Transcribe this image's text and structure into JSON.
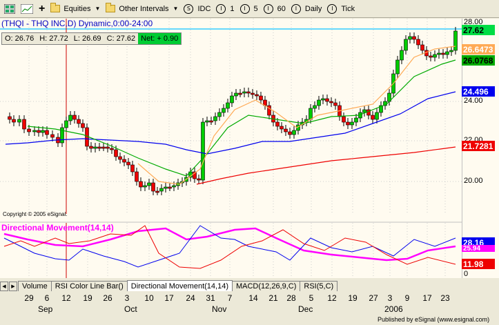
{
  "toolbar": {
    "items": [
      {
        "name": "grid-icon",
        "label": ""
      },
      {
        "name": "chart-icon",
        "label": ""
      },
      {
        "name": "plus-icon",
        "label": "+"
      },
      {
        "name": "equities-menu",
        "label": "Equities"
      },
      {
        "name": "other-intervals-menu",
        "label": "Other Intervals"
      },
      {
        "name": "interval-s",
        "glyph": "S",
        "label": "IDC"
      },
      {
        "name": "interval-1",
        "glyph": "I",
        "label": "1"
      },
      {
        "name": "interval-5",
        "glyph": "I",
        "label": "5"
      },
      {
        "name": "interval-60",
        "glyph": "I",
        "label": "60"
      },
      {
        "name": "interval-daily",
        "glyph": "I",
        "label": "Daily"
      },
      {
        "name": "interval-tick",
        "glyph": "I",
        "label": "Tick"
      }
    ]
  },
  "chart": {
    "title": "(THQI - THQ INC,D) Dynamic,0:00-24:00",
    "ohlc": {
      "o": "O: 26.76",
      "h": "H: 27.72",
      "l": "L: 26.69",
      "c": "C: 27.62",
      "net": "Net: + 0.90"
    },
    "copyright": "Copyright © 2005 eSignal.",
    "price_axis": [
      "28.00",
      "24.00",
      "22.00",
      "20.00"
    ],
    "tags": [
      {
        "label": "27.62",
        "bg": "#00dd44",
        "fg": "#000000"
      },
      {
        "label": "26.6473",
        "bg": "#ffaa55",
        "fg": "#ffffff"
      },
      {
        "label": "26.0768",
        "bg": "#00aa00",
        "fg": "#000000"
      },
      {
        "label": "24.496",
        "bg": "#0000ee",
        "fg": "#ffffff"
      },
      {
        "label": "21.7281",
        "bg": "#ee0000",
        "fg": "#ffffff"
      }
    ],
    "indicator_title": "Directional Movement(14,14)",
    "indicator_axis": [
      "0"
    ],
    "indicator_tags": [
      {
        "label": "28.16",
        "bg": "#0000ee",
        "fg": "#ffffff"
      },
      {
        "label": "25.94",
        "bg": "#ff00ff",
        "fg": "#ffffff"
      },
      {
        "label": "11.98",
        "bg": "#ee0000",
        "fg": "#ffffff"
      }
    ]
  },
  "tabs": [
    "Volume",
    "RSI Color Line Bar()",
    "Directional Movement(14,14)",
    "MACD(12,26,9,C)",
    "RSI(5,C)"
  ],
  "active_tab": "Directional Movement(14,14)",
  "xaxis": {
    "ticks": [
      "29",
      "6",
      "12",
      "19",
      "26",
      "3",
      "10",
      "17",
      "24",
      "31",
      "7",
      "14",
      "21",
      "28",
      "5",
      "12",
      "19",
      "27",
      "3",
      "9",
      "17",
      "23"
    ],
    "months": [
      "Sep",
      "Oct",
      "Nov",
      "Dec",
      "2006"
    ]
  },
  "footer": "Published by eSignal (www.esignal.com)",
  "colors": {
    "background": "#fffbf0",
    "up_candle": "#00cc00",
    "down_candle": "#ee0000",
    "plus_di": "#0000ee",
    "minus_di": "#ee0000",
    "adx": "#ff00ff",
    "ma_short": "#ffaa55",
    "ma_mid": "#00aa00",
    "ma_long_blue": "#0000ee",
    "ma_long_red": "#ee0000"
  }
}
